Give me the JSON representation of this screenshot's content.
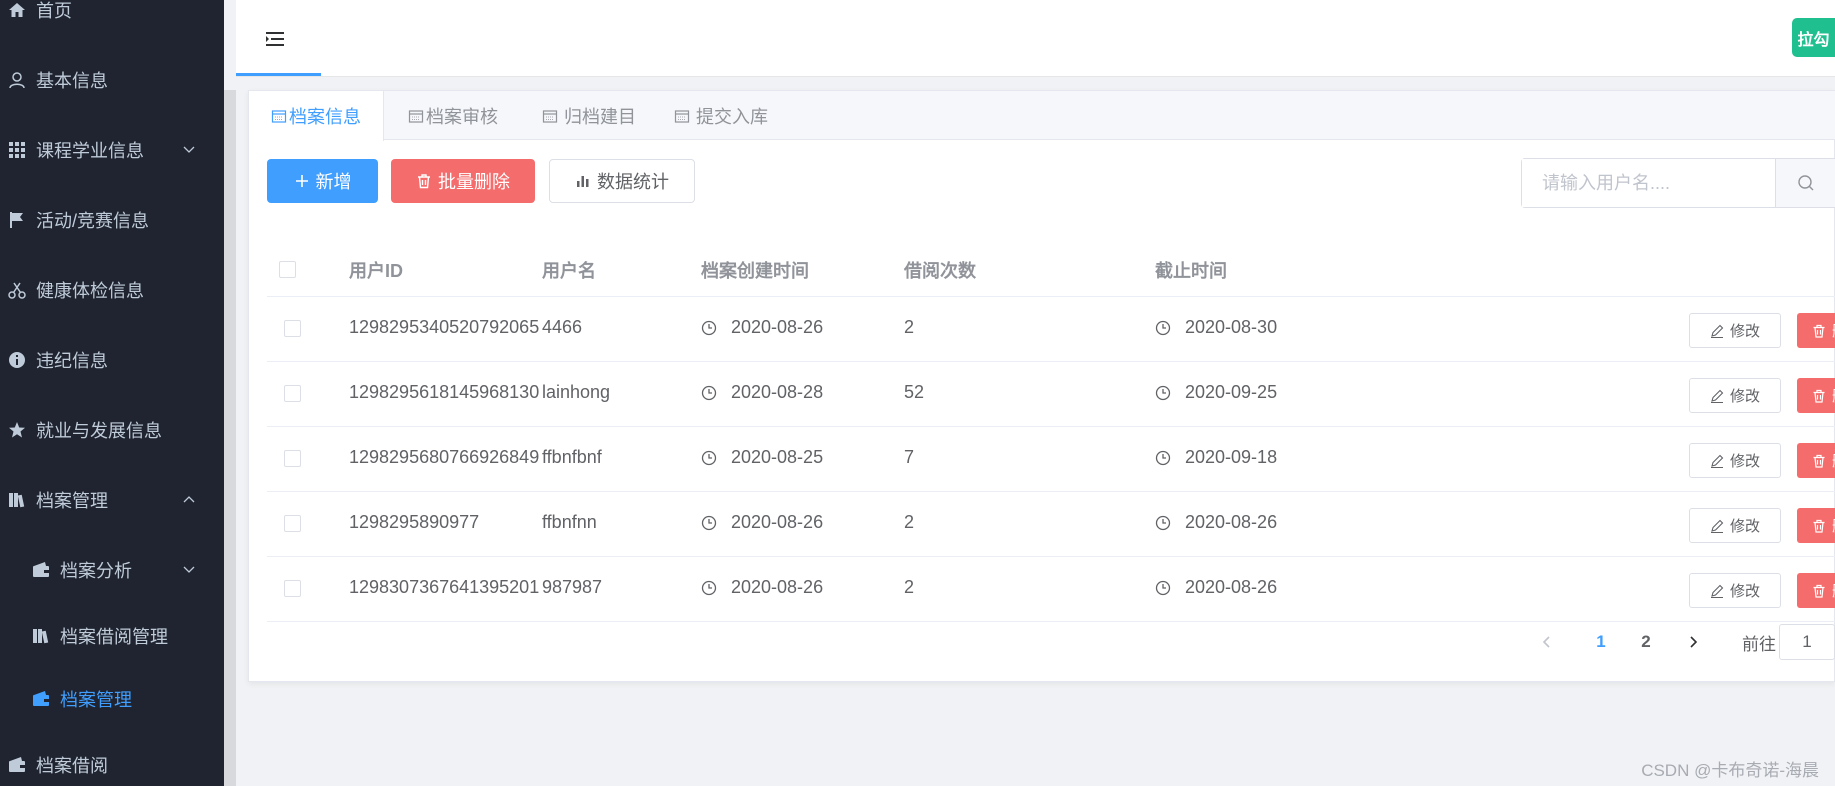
{
  "sidebar": {
    "items": [
      {
        "label": "首页",
        "icon": "home-icon"
      },
      {
        "label": "基本信息",
        "icon": "user-icon"
      },
      {
        "label": "课程学业信息",
        "icon": "grid-icon"
      },
      {
        "label": "活动/竞赛信息",
        "icon": "flag-icon"
      },
      {
        "label": "健康体检信息",
        "icon": "scissors-icon"
      },
      {
        "label": "违纪信息",
        "icon": "info-icon"
      },
      {
        "label": "就业与发展信息",
        "icon": "star-icon"
      },
      {
        "label": "档案管理",
        "icon": "books-icon"
      },
      {
        "label": "档案分析",
        "icon": "wallet-icon"
      },
      {
        "label": "档案借阅管理",
        "icon": "books-icon"
      },
      {
        "label": "档案管理",
        "icon": "wallet-icon",
        "active": true
      },
      {
        "label": "档案借阅",
        "icon": "wallet-icon"
      }
    ]
  },
  "header": {
    "avatar_text": "拉勾"
  },
  "tabs": [
    {
      "label": "档案信息",
      "active": true
    },
    {
      "label": "档案审核"
    },
    {
      "label": "归档建目"
    },
    {
      "label": "提交入库"
    }
  ],
  "toolbar": {
    "add_label": "新增",
    "batch_delete_label": "批量删除",
    "stats_label": "数据统计",
    "search_placeholder": "请输入用户名...."
  },
  "table": {
    "columns": [
      "用户ID",
      "用户名",
      "档案创建时间",
      "借阅次数",
      "截止时间"
    ],
    "rows": [
      {
        "id": "1298295340520792065",
        "name": "4466",
        "created": "2020-08-26",
        "count": "2",
        "deadline": "2020-08-30"
      },
      {
        "id": "1298295618145968130",
        "name": "lainhong",
        "created": "2020-08-28",
        "count": "52",
        "deadline": "2020-09-25"
      },
      {
        "id": "1298295680766926849",
        "name": "ffbnfbnf",
        "created": "2020-08-25",
        "count": "7",
        "deadline": "2020-09-18"
      },
      {
        "id": "1298295890977",
        "name": "ffbnfnn",
        "created": "2020-08-26",
        "count": "2",
        "deadline": "2020-08-26"
      },
      {
        "id": "1298307367641395201",
        "name": "987987",
        "created": "2020-08-26",
        "count": "2",
        "deadline": "2020-08-26"
      }
    ],
    "edit_label": "修改",
    "delete_label": "删除"
  },
  "pagination": {
    "pages": [
      "1",
      "2"
    ],
    "current": "1",
    "goto_label": "前往",
    "goto_value": "1"
  },
  "watermark": "CSDN @卡布奇诺-海晨",
  "colors": {
    "sidebar_bg": "#1f2430",
    "primary": "#409eff",
    "danger": "#f56c6c",
    "avatar_bg": "#1fbf8f"
  }
}
